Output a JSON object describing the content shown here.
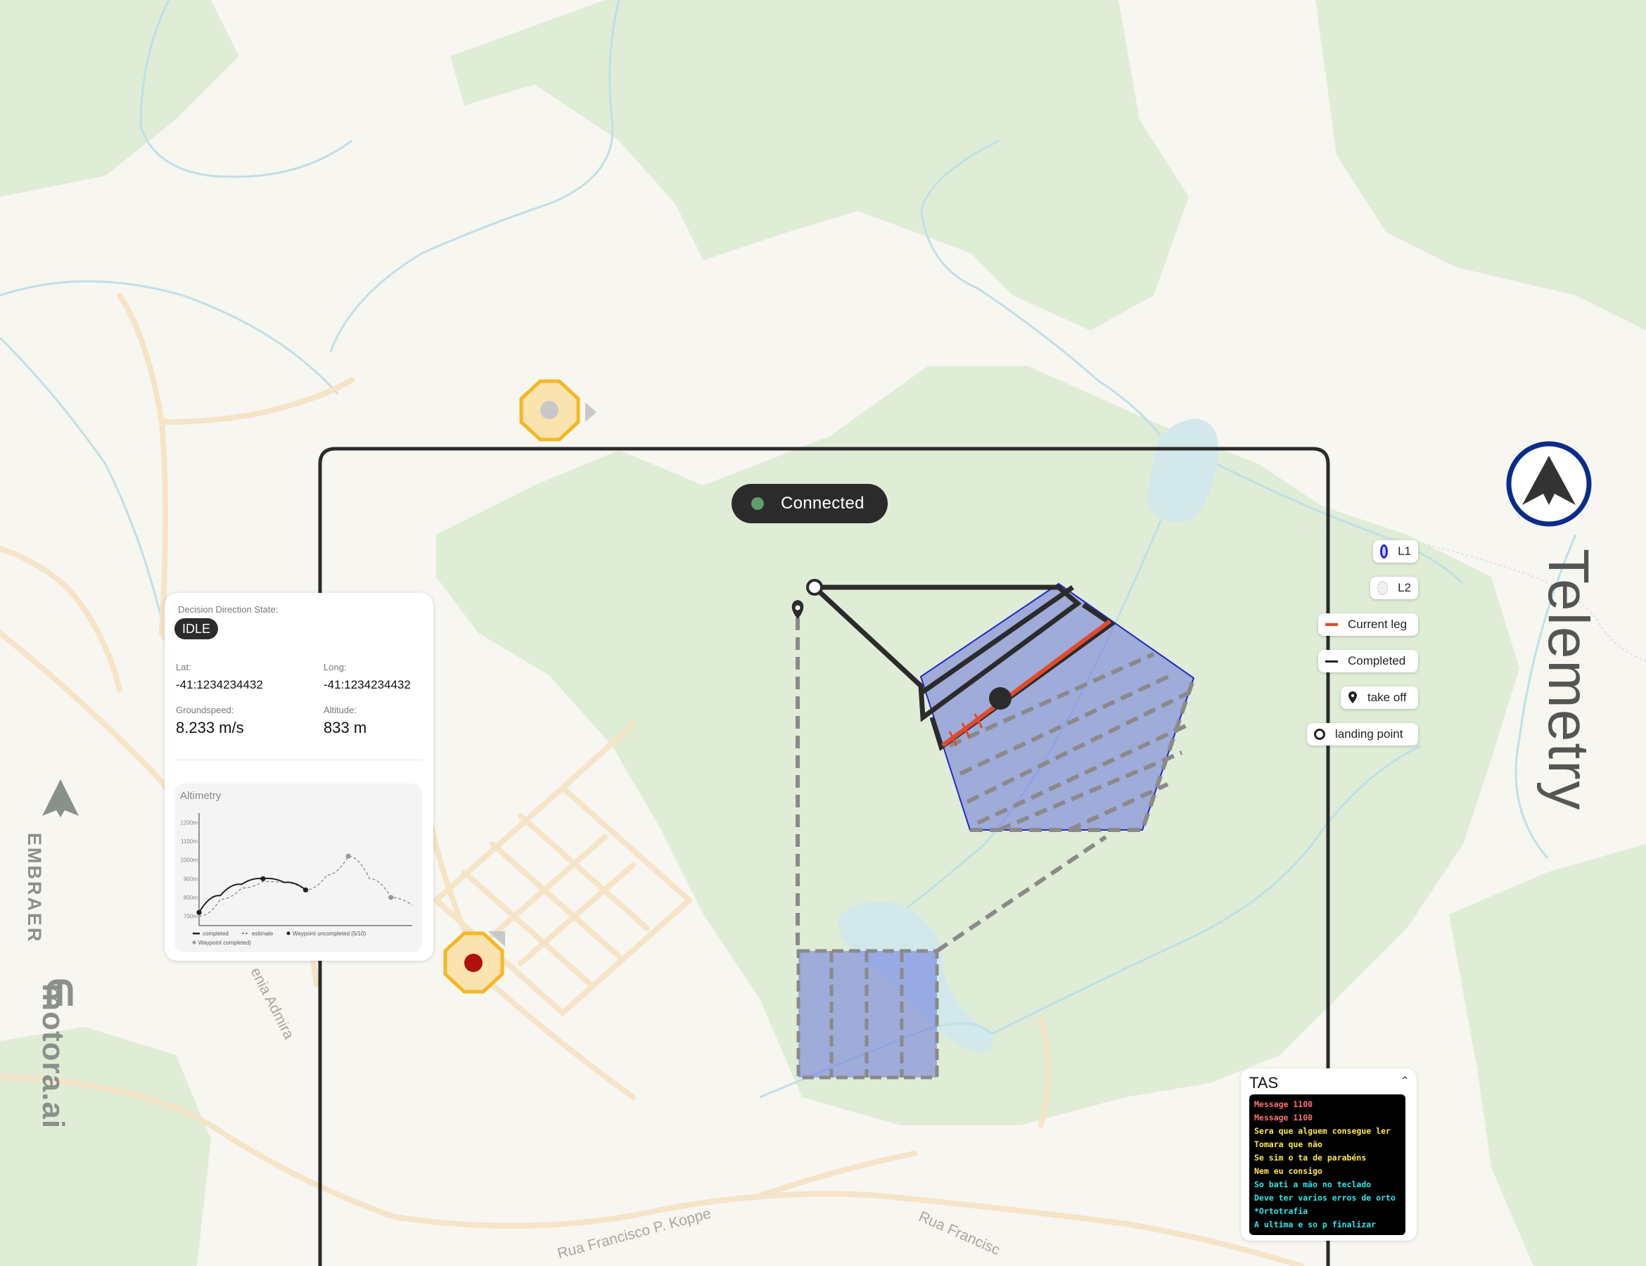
{
  "connection": {
    "label": "Connected",
    "status_color": "#5e9e6b"
  },
  "decision_panel": {
    "state_label": "Decision Direction State:",
    "state_value": "IDLE",
    "lat_label": "Lat:",
    "lat_value": "-41:1234234432",
    "long_label": "Long:",
    "long_value": "-41:1234234432",
    "groundspeed_label": "Groundspeed:",
    "groundspeed_value": "8.233 m/s",
    "altitude_label": "Altitude:",
    "altitude_value": "833 m"
  },
  "chart_data": {
    "type": "line",
    "title": "Altimetry",
    "y_ticks": [
      "1200m",
      "1100m",
      "1000m",
      "900m",
      "800m",
      "700m"
    ],
    "ylim": [
      650,
      1250
    ],
    "xlim": [
      0,
      10
    ],
    "series": [
      {
        "name": "completed",
        "style": "solid",
        "points": [
          [
            0,
            720
          ],
          [
            1,
            810
          ],
          [
            2,
            870
          ],
          [
            3,
            900
          ],
          [
            4,
            880
          ],
          [
            5,
            840
          ]
        ]
      },
      {
        "name": "estimate",
        "style": "dashed",
        "points": [
          [
            0,
            700
          ],
          [
            1,
            790
          ],
          [
            2,
            850
          ],
          [
            3,
            885
          ],
          [
            4,
            880
          ],
          [
            5,
            840
          ],
          [
            6,
            920
          ],
          [
            7,
            1020
          ],
          [
            8,
            900
          ],
          [
            9,
            800
          ],
          [
            10,
            760
          ]
        ]
      }
    ],
    "waypoints_completed": [
      [
        0,
        720
      ],
      [
        3,
        900
      ],
      [
        5,
        840
      ]
    ],
    "waypoints_uncompleted": [
      [
        7,
        1020
      ],
      [
        9,
        800
      ]
    ],
    "legend": [
      "completed",
      "estimate",
      "Waypoint uncompleted (5/10)",
      "Waypoint completed)"
    ]
  },
  "legend": {
    "l1": "L1",
    "l2": "L2",
    "current_leg": "Current leg",
    "completed": "Completed",
    "take_off": "take off",
    "landing_point": "landing point",
    "l1_color": "#2228c8",
    "current_leg_color": "#e24a2a"
  },
  "telemetry": {
    "title": "Telemetry",
    "brand_color": "#0b2c8a"
  },
  "tas": {
    "title": "TAS",
    "messages": [
      {
        "text": "Message 1100",
        "color": "#ff7070"
      },
      {
        "text": "Message 1100",
        "color": "#ff7070"
      },
      {
        "text": "Sera que alguem consegue ler",
        "color": "#ffe94a"
      },
      {
        "text": "Tomara que não",
        "color": "#ffe94a"
      },
      {
        "text": "Se sim o ta de parabéns",
        "color": "#ffe94a"
      },
      {
        "text": "Nem eu consigo",
        "color": "#ffe94a"
      },
      {
        "text": "So bati a mão no teclado",
        "color": "#2fe8e8"
      },
      {
        "text": "Deve ter varios erros de orto",
        "color": "#2fe8e8"
      },
      {
        "text": "*Ortotrafia",
        "color": "#2fe8e8"
      },
      {
        "text": "A ultima e so p finalizar",
        "color": "#2fe8e8"
      }
    ]
  },
  "branding": {
    "embraer": "EMBRAER",
    "motora": "motora.ai"
  },
  "streets": {
    "a": "Rua Francisco P. Koppe",
    "b": "Rua Francisc",
    "c": "enia Admira"
  }
}
